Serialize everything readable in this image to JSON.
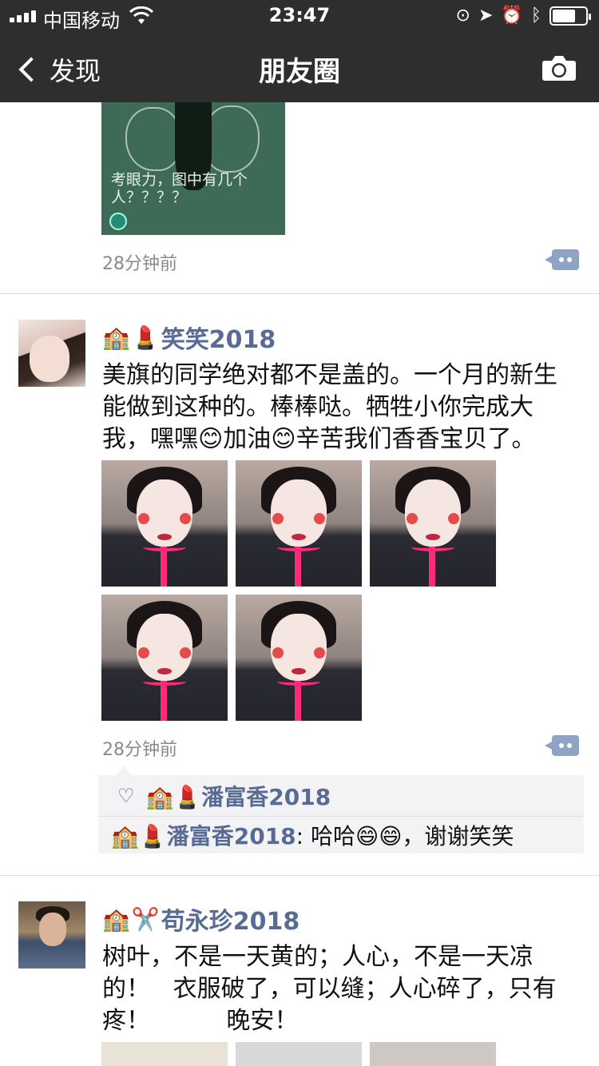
{
  "status_bar": {
    "carrier": "中国移动",
    "time": "23:47",
    "icons": [
      "signal-icon",
      "wifi-icon",
      "orientation-lock-icon",
      "location-icon",
      "alarm-icon",
      "bluetooth-icon",
      "battery-icon"
    ],
    "battery_level": 0.7
  },
  "nav": {
    "back_label": "发现",
    "title": "朋友圈",
    "right_icon": "camera-icon"
  },
  "posts": [
    {
      "image_caption": "考眼力，图中有几个人？？？？",
      "time": "28分钟前"
    },
    {
      "name": "笑笑2018",
      "name_emojis": [
        "🏫",
        "💄"
      ],
      "text": "美旗的同学绝对都不是盖的。一个月的新生能做到这种的。棒棒哒。牺牲小你完成大我，嘿嘿😊加油😊辛苦我们香香宝贝了。",
      "photos": 5,
      "time": "28分钟前",
      "likes": {
        "names": [
          "🏫💄潘富香2018"
        ]
      },
      "comments": [
        {
          "author": "🏫💄潘富香2018",
          "text": ": 哈哈😄😄，谢谢笑笑"
        }
      ]
    },
    {
      "name": "苟永珍2018",
      "name_emojis": [
        "🏫",
        "✂️"
      ],
      "text": "树叶，不是一天黄的；人心，不是一天凉的！   衣服破了，可以缝；人心碎了，只有疼！          晚安！"
    }
  ],
  "colors": {
    "bar_bg": "#2e2e2e",
    "name_link": "#576b95",
    "timestamp": "#8a8a8a",
    "comment_bg": "#f3f3f5"
  }
}
